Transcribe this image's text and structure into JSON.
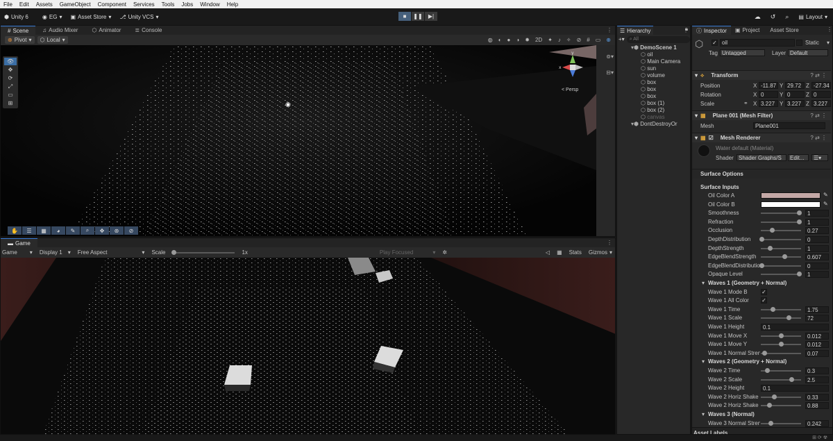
{
  "menu": [
    "File",
    "Edit",
    "Assets",
    "GameObject",
    "Component",
    "Services",
    "Tools",
    "Jobs",
    "Window",
    "Help"
  ],
  "toolbar": {
    "unity": "Unity 6",
    "account": "EG",
    "asset_store": "Asset Store",
    "vcs": "Unity VCS",
    "layout": "Layout"
  },
  "scene_tabs": [
    "Scene",
    "Audio Mixer",
    "Animator",
    "Console"
  ],
  "scene_toolbar": {
    "pivot": "Pivot",
    "local": "Local"
  },
  "scene_persp": "< Persp",
  "game_tab": "Game",
  "game_toolbar": {
    "game": "Game",
    "display": "Display 1",
    "aspect": "Free Aspect",
    "scale_label": "Scale",
    "scale_value": "1x",
    "play_focused": "Play Focused",
    "stats": "Stats",
    "gizmos": "Gizmos"
  },
  "hierarchy": {
    "tab": "Hierarchy",
    "search_placeholder": "All",
    "root": "DemoScene 1",
    "items": [
      "oil",
      "Main Camera",
      "sun",
      "volume",
      "box",
      "box",
      "box",
      "box (1)",
      "box (2)",
      "canvas"
    ],
    "dontdestroy": "DontDestroyOr"
  },
  "inspector": {
    "tabs": [
      "Inspector",
      "Project",
      "Asset Store"
    ],
    "object_name": "oil",
    "static_label": "Static",
    "tag_label": "Tag",
    "tag_value": "Untagged",
    "layer_label": "Layer",
    "layer_value": "Default",
    "transform": {
      "title": "Transform",
      "position": {
        "label": "Position",
        "x": "-11.87",
        "y": "29.72",
        "z": "-27.34"
      },
      "rotation": {
        "label": "Rotation",
        "x": "0",
        "y": "0",
        "z": "0"
      },
      "scale": {
        "label": "Scale",
        "x": "3.227",
        "y": "3.227",
        "z": "3.227"
      }
    },
    "mesh_filter": {
      "title": "Plane 001 (Mesh Filter)",
      "mesh_label": "Mesh",
      "mesh_value": "Plane001"
    },
    "mesh_renderer": {
      "title": "Mesh Renderer"
    },
    "material": {
      "name": "Water default (Material)",
      "shader_label": "Shader",
      "shader_value": "Shader Graphs/S",
      "edit": "Edit..."
    },
    "surface_options": "Surface Options",
    "surface_inputs": "Surface Inputs",
    "props": [
      {
        "label": "Oil Color A",
        "kind": "color",
        "color": "#c4a8a6"
      },
      {
        "label": "Oil Color B",
        "kind": "color",
        "color": "#ffffff"
      },
      {
        "label": "Smoothness",
        "kind": "slider",
        "value": "1",
        "frac": 1.0
      },
      {
        "label": "Refraction",
        "kind": "slider",
        "value": "1",
        "frac": 1.0
      },
      {
        "label": "Occlusion",
        "kind": "slider",
        "value": "0.27",
        "frac": 0.27
      },
      {
        "label": "DepthDistribution",
        "kind": "slider",
        "value": "0",
        "frac": 0.0
      },
      {
        "label": "DepthStrength",
        "kind": "slider",
        "value": "1",
        "frac": 0.22
      },
      {
        "label": "EdgeBlendStrength",
        "kind": "slider",
        "value": "0.607",
        "frac": 0.607
      },
      {
        "label": "EdgeBlendDistributio",
        "kind": "slider",
        "value": "0",
        "frac": 0.0
      },
      {
        "label": "Opaque Level",
        "kind": "slider",
        "value": "1",
        "frac": 1.0
      },
      {
        "label": "Waves 1 (Geometry + Normal)",
        "kind": "header"
      },
      {
        "label": "Wave 1 Mode B",
        "kind": "check"
      },
      {
        "label": "Wave 1 All Color",
        "kind": "check"
      },
      {
        "label": "Wave 1 Time",
        "kind": "slider",
        "value": "1.75",
        "frac": 0.3
      },
      {
        "label": "Wave 1 Scale",
        "kind": "slider",
        "value": "72",
        "frac": 0.72
      },
      {
        "label": "Wave 1 Height",
        "kind": "field",
        "value": "0.1"
      },
      {
        "label": "Wave 1 Move X",
        "kind": "slider",
        "value": "0.012",
        "frac": 0.52
      },
      {
        "label": "Wave 1 Move Y",
        "kind": "slider",
        "value": "0.012",
        "frac": 0.52
      },
      {
        "label": "Wave 1 Normal Streng",
        "kind": "slider",
        "value": "0.07",
        "frac": 0.07
      },
      {
        "label": "Waves 2 (Geometry + Normal)",
        "kind": "header"
      },
      {
        "label": "Wave 2 Time",
        "kind": "slider",
        "value": "0.3",
        "frac": 0.15
      },
      {
        "label": "Wave 2 Scale",
        "kind": "slider",
        "value": "2.5",
        "frac": 0.8
      },
      {
        "label": "Wave 2 Height",
        "kind": "field",
        "value": "0.1"
      },
      {
        "label": "Wave 2 Horiz Shake",
        "kind": "slider",
        "value": "0.33",
        "frac": 0.33
      },
      {
        "label": "Wave 2 Horiz Shake",
        "kind": "slider",
        "value": "0.88",
        "frac": 0.2
      },
      {
        "label": "Waves 3 (Normal)",
        "kind": "header"
      },
      {
        "label": "Wave 3 Normal Streng",
        "kind": "slider",
        "value": "0.242",
        "frac": 0.242
      }
    ],
    "asset_labels": "Asset Labels"
  },
  "colors": {
    "accent": "#3b7dd8",
    "water_edge": "#5a2e2b"
  }
}
